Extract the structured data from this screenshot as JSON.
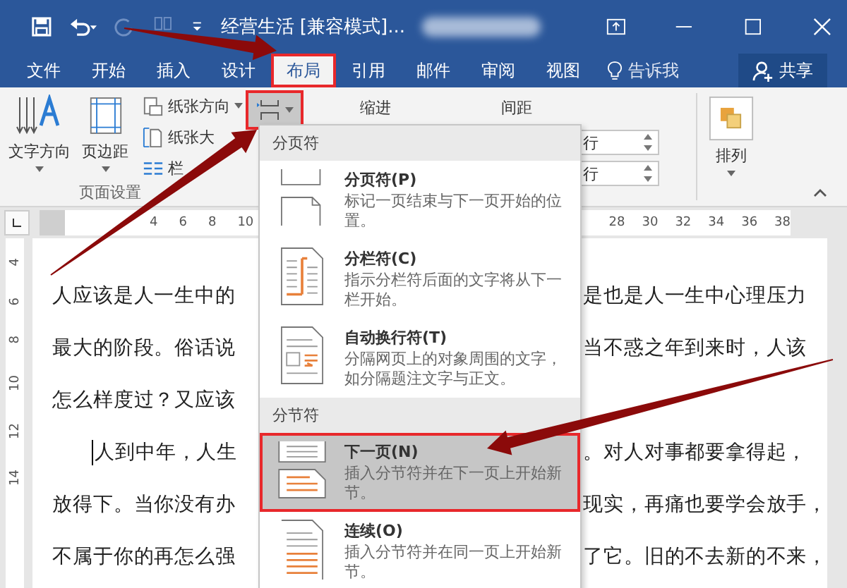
{
  "window": {
    "title": "经营生活 [兼容模式]..."
  },
  "tabs": [
    {
      "label": "文件",
      "selected": false,
      "highlighted": false
    },
    {
      "label": "开始",
      "selected": false,
      "highlighted": false
    },
    {
      "label": "插入",
      "selected": false,
      "highlighted": false
    },
    {
      "label": "设计",
      "selected": false,
      "highlighted": false
    },
    {
      "label": "布局",
      "selected": true,
      "highlighted": true
    },
    {
      "label": "引用",
      "selected": false,
      "highlighted": false
    },
    {
      "label": "邮件",
      "selected": false,
      "highlighted": false
    },
    {
      "label": "审阅",
      "selected": false,
      "highlighted": false
    },
    {
      "label": "视图",
      "selected": false,
      "highlighted": false
    }
  ],
  "tell_me": "告诉我",
  "share_button": "共享",
  "ribbon": {
    "text_direction": "文字方向",
    "margins": "页边距",
    "orientation": "纸张方向",
    "size": "纸张大",
    "columns": "栏",
    "breaks_highlighted": true,
    "group_label": "页面设置",
    "indent_label": "缩进",
    "spacing_label": "间距",
    "spin_values": [
      "行",
      "行"
    ],
    "arrange": "排列"
  },
  "ruler": {
    "left_ticks": [
      "4",
      "6",
      "8",
      "10"
    ],
    "right_ticks": [
      "28",
      "30",
      "32",
      "34",
      "36",
      "38"
    ],
    "vertical_ticks": [
      "4",
      "6",
      "8",
      "10",
      "12",
      "14"
    ]
  },
  "breaks_menu": {
    "sections": [
      {
        "header": "分页符",
        "items": [
          {
            "kind": "page_break",
            "title": "分页符(P)",
            "description": "标记一页结束与下一页开始的位置。",
            "selected": false,
            "highlighted": false
          },
          {
            "kind": "column_break",
            "title": "分栏符(C)",
            "description": "指示分栏符后面的文字将从下一栏开始。",
            "selected": false,
            "highlighted": false
          },
          {
            "kind": "text_wrap",
            "title": "自动换行符(T)",
            "description": "分隔网页上的对象周围的文字，如分隔题注文字与正文。",
            "selected": false,
            "highlighted": false
          }
        ]
      },
      {
        "header": "分节符",
        "items": [
          {
            "kind": "next_page",
            "title": "下一页(N)",
            "description": "插入分节符并在下一页上开始新节。",
            "selected": true,
            "highlighted": true
          },
          {
            "kind": "continuous",
            "title": "连续(O)",
            "description": "插入分节符并在同一页上开始新节。",
            "selected": false,
            "highlighted": false
          }
        ]
      }
    ]
  },
  "document": {
    "lines": [
      {
        "left": "人应该是人一生中的",
        "right": "是也是人一生中心理压力",
        "paragraph_start": false,
        "caret": false
      },
      {
        "left": "最大的阶段。俗话说",
        "right": "当不惑之年到来时，人该",
        "paragraph_start": false,
        "caret": false
      },
      {
        "left": "怎么样度过？又应该",
        "paragraph_start": false,
        "caret": false
      },
      {
        "left": "人到中年，人生",
        "right": "。对人对事都要拿得起，",
        "paragraph_start": true,
        "caret": true
      },
      {
        "left": "放得下。当你没有办",
        "right": "现实，再痛也要学会放手，",
        "paragraph_start": false,
        "caret": false
      },
      {
        "left": "不属于你的再怎么强",
        "right": "了它。旧的不去新的不来，",
        "paragraph_start": false,
        "caret": false
      }
    ]
  }
}
